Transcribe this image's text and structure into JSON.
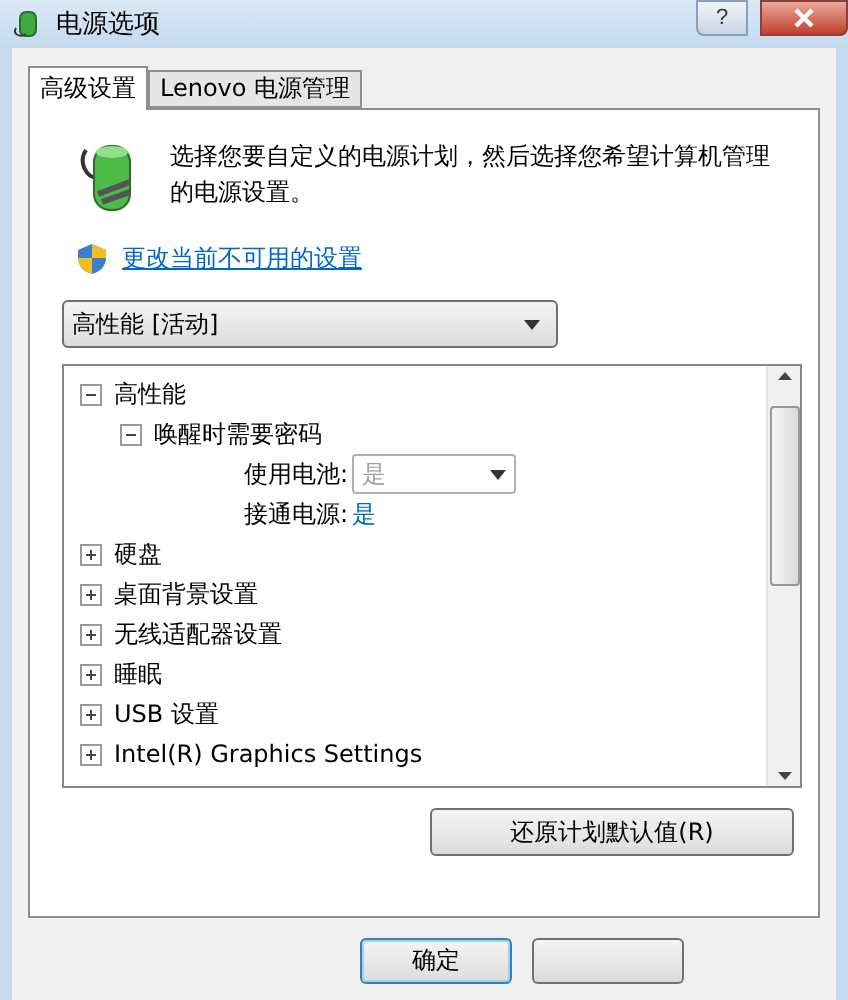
{
  "window": {
    "title": "电源选项",
    "help": "?"
  },
  "tabs": [
    {
      "label": "高级设置",
      "selected": true
    },
    {
      "label": "Lenovo 电源管理",
      "selected": false
    }
  ],
  "intro": "选择您要自定义的电源计划，然后选择您希望计算机管理的电源设置。",
  "link": "更改当前不可用的设置",
  "plan": {
    "value": "高性能 [活动]"
  },
  "tree": [
    {
      "label": "高性能",
      "expanded": true,
      "children": [
        {
          "label": "唤醒时需要密码",
          "expanded": true,
          "settings": [
            {
              "kind": "dropdown",
              "label": "使用电池:",
              "value": "是",
              "disabled": true
            },
            {
              "kind": "link",
              "label": "接通电源:",
              "value": "是"
            }
          ]
        }
      ]
    },
    {
      "label": "硬盘",
      "expanded": false
    },
    {
      "label": "桌面背景设置",
      "expanded": false
    },
    {
      "label": "无线适配器设置",
      "expanded": false
    },
    {
      "label": "睡眠",
      "expanded": false
    },
    {
      "label": "USB 设置",
      "expanded": false
    },
    {
      "label": "Intel(R) Graphics Settings",
      "expanded": false
    }
  ],
  "restore_button": "还原计划默认值(R)",
  "buttons": [
    {
      "kind": "ok",
      "label": "确定"
    },
    {
      "kind": "cancel"
    }
  ]
}
